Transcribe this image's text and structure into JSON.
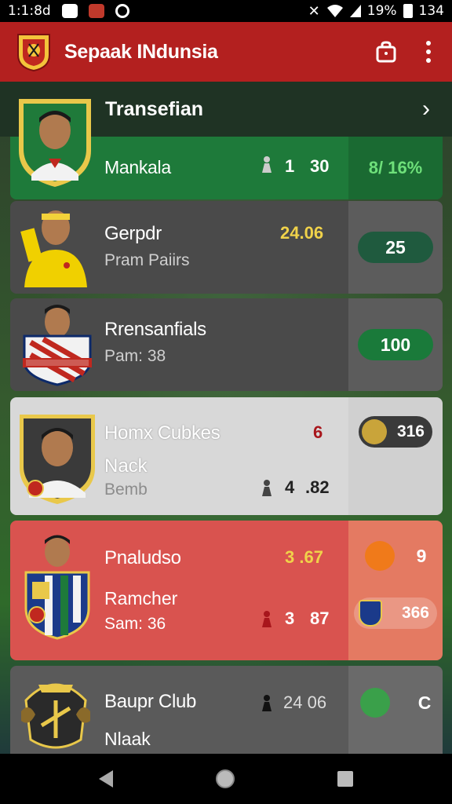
{
  "status_bar": {
    "time": "1:1:8d",
    "battery": "19%",
    "right_text": "134"
  },
  "app": {
    "title": "Sepaak INdunsia"
  },
  "section": {
    "title": "Transefian"
  },
  "cards": [
    {
      "name": "Mankala",
      "stat_count": "1",
      "stat_value": "30",
      "side_text": "8/  16%"
    },
    {
      "name": "Gerpdr",
      "sub": "Pram Paiirs",
      "stat_value": "24.06",
      "side_text": "25"
    },
    {
      "name": "Rrensanfials",
      "sub": "Pam: 38",
      "side_text": "100"
    },
    {
      "name": "Homx Cubkes",
      "sub": "Nack",
      "sub2": "Bemb",
      "stat_top": "6",
      "stat_count": "4",
      "stat_value": ".82",
      "side_text": "316"
    },
    {
      "name": "Pnaludso",
      "sub": "Ramcher",
      "sub2": "Sam: 36",
      "stat_top": "3 .67",
      "stat_count": "3",
      "stat_value": "87",
      "side_text": "9",
      "side_text2": "366"
    },
    {
      "name": "Baupr Club",
      "sub": "Nlaak",
      "stat_value": "24 06",
      "side_text": "C"
    }
  ],
  "colors": {
    "app_bar": "#b3201f",
    "green": "#1e7a3a",
    "red_card": "#d9534f",
    "pill_dark": "#1f5a3e",
    "pill_green": "#1a7a3a",
    "yellow": "#f0d24a"
  }
}
